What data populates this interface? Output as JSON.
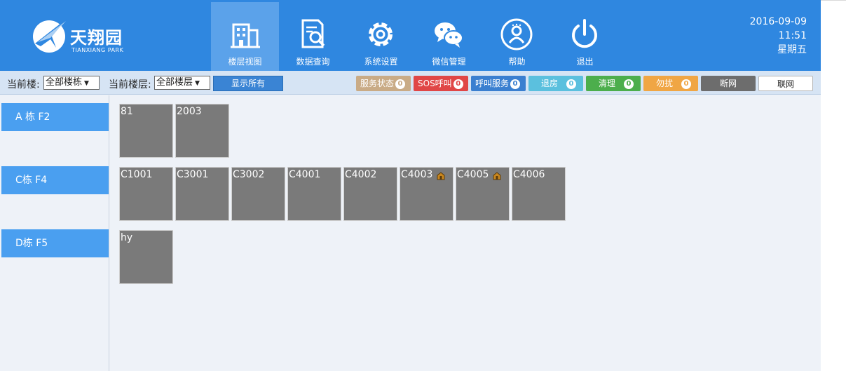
{
  "header": {
    "logo_main": "天翔园",
    "logo_sub": "TIANXIANG PARK",
    "nav": [
      {
        "label": "楼层视图",
        "icon": "building-icon"
      },
      {
        "label": "数据查询",
        "icon": "document-search-icon"
      },
      {
        "label": "系统设置",
        "icon": "gear-icon"
      },
      {
        "label": "微信管理",
        "icon": "wechat-icon"
      },
      {
        "label": "帮助",
        "icon": "help-person-icon"
      },
      {
        "label": "退出",
        "icon": "power-icon"
      }
    ],
    "date": "2016-09-09",
    "time": "11:51",
    "weekday": "星期五"
  },
  "toolbar": {
    "building_label": "当前楼:",
    "building_value": "全部楼栋",
    "floor_label": "当前楼层:",
    "floor_value": "全部楼层",
    "show_all": "显示所有",
    "status": [
      {
        "label": "服务状态",
        "count": "0",
        "color": "#c9ab86"
      },
      {
        "label": "SOS呼叫",
        "count": "0",
        "color": "#e04646"
      },
      {
        "label": "呼叫服务",
        "count": "0",
        "color": "#3a7fd0"
      },
      {
        "label": "退房",
        "count": "0",
        "color": "#5bc0de"
      },
      {
        "label": "清理",
        "count": "0",
        "color": "#4cae4c"
      },
      {
        "label": "勿扰",
        "count": "0",
        "color": "#f0a644"
      }
    ],
    "disconnect": "断网",
    "connect": "联网"
  },
  "floors": [
    {
      "label": "A 栋 F2",
      "rooms": [
        {
          "name": "81"
        },
        {
          "name": "2003"
        }
      ]
    },
    {
      "label": "C栋 F4",
      "rooms": [
        {
          "name": "C1001"
        },
        {
          "name": "C3001"
        },
        {
          "name": "C3002"
        },
        {
          "name": "C4001"
        },
        {
          "name": "C4002"
        },
        {
          "name": "C4003",
          "icon": "lock-icon"
        },
        {
          "name": "C4005",
          "icon": "lock-icon"
        },
        {
          "name": "C4006"
        }
      ]
    },
    {
      "label": "D栋 F5",
      "rooms": [
        {
          "name": "hy"
        }
      ]
    }
  ]
}
